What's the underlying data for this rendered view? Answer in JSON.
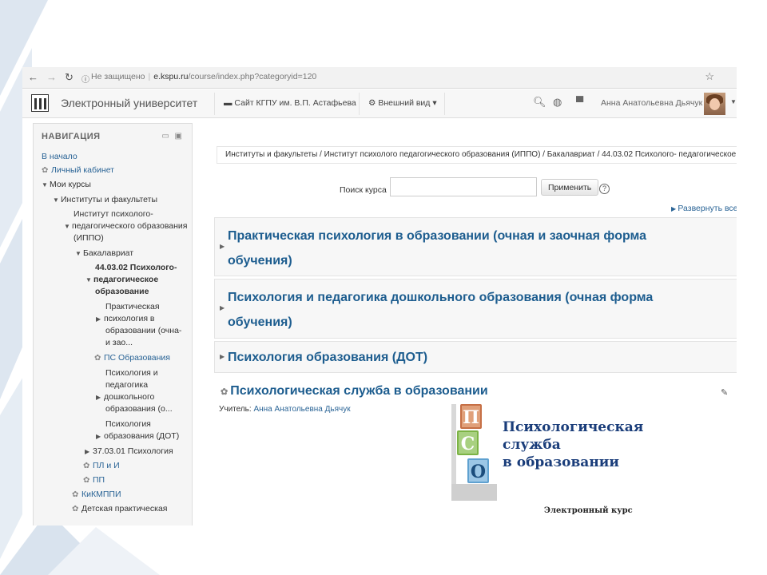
{
  "address": {
    "url_insecure": "Не защищено",
    "url_domain": "e.kspu.ru",
    "url_path": "/course/index.php?categoryid=120"
  },
  "topbar": {
    "brand": "Электронный университет",
    "menu_site": "Сайт КГПУ им. В.П. Астафьева",
    "menu_view": "Внешний вид",
    "user_name": "Анна Анатольевна Дьячук"
  },
  "sidebar": {
    "heading": "НАВИГАЦИЯ",
    "items": {
      "home": "В начало",
      "cabinet": "Личный кабинет",
      "my_courses": "Мои курсы",
      "institutes": "Институты и факультеты",
      "ippo_1": "Институт психолого-",
      "ippo_2": "педагогического образования",
      "ippo_3": "(ИППО)",
      "bachelor": "Бакалавриат",
      "spec_1": "44.03.02 Психолого-",
      "spec_2": "педагогическое",
      "spec_3": "образование",
      "c1_1": "Практическая",
      "c1_2": "психология в",
      "c1_3": "образовании (очна-",
      "c1_4": "и зао...",
      "ps": "ПС Образования",
      "c2_1": "Психология и",
      "c2_2": "педагогика",
      "c2_3": "дошкольного",
      "c2_4": "образования (о...",
      "c3_1": "Психология",
      "c3_2": "образования (ДОТ)",
      "psy": "37.03.01 Психология",
      "pli": "ПЛ и И",
      "pp": "ПП",
      "kikmppi": "КиКМППИ",
      "kids": "Детская практическая"
    }
  },
  "main": {
    "breadcrumb": "Институты и факультеты / Институт психолого педагогического образования (ИППО) / Бакалавриат / 44.03.02 Психолого- педагогическое",
    "search_label": "Поиск курса",
    "search_value": "",
    "apply_label": "Применить",
    "expand_label": "Развернуть все",
    "categories": [
      {
        "line1": "Практическая психология в образовании (очная и заочная форма",
        "line2": "обучения)"
      },
      {
        "line1": "Психология и педагогика дошкольного образования (очная форма",
        "line2": "обучения)"
      },
      {
        "line1": "Психология образования (ДОТ)"
      }
    ],
    "course": {
      "title": "Психологическая служба в образовании",
      "teacher_label": "Учитель:",
      "teacher_name": "Анна Анатольевна Дьячук",
      "blocks": [
        "П",
        "С",
        "О"
      ],
      "image_line1": "Психологическая",
      "image_line2": "служба",
      "image_line3": "в образовании",
      "image_caption": "Электронный курс"
    }
  }
}
